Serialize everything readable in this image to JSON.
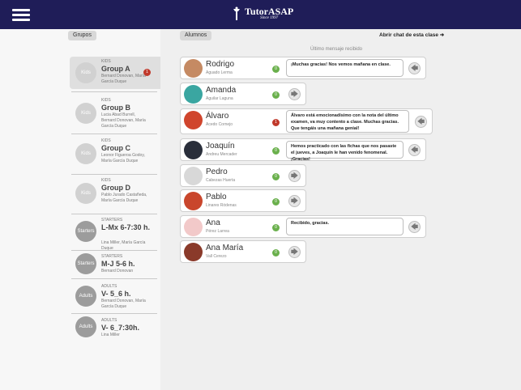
{
  "header": {
    "brand": "TutorASAP",
    "since": "Since 1997"
  },
  "left": {
    "tab_label": "Grupos",
    "groups": [
      {
        "kind": "KIDS",
        "name": "Group A",
        "members": "Bernard Donovan, María García Duque",
        "avatar": "Kids",
        "badge": "1"
      },
      {
        "kind": "KIDS",
        "name": "Group B",
        "members": "Lucia Abad Burrell, Bernard Donovan, María García Duque",
        "avatar": "Kids"
      },
      {
        "kind": "KIDS",
        "name": "Group C",
        "members": "Leonor Figueroa Godoy, María García Duque",
        "avatar": "Kids"
      },
      {
        "kind": "KIDS",
        "name": "Group D",
        "members": "Pablo Jurado Castañeda, María García Duque",
        "avatar": "Kids"
      },
      {
        "kind": "STARTERS",
        "name": "L-Mx 6-7:30 h.",
        "members": "Lina Miller, María García Duque",
        "avatar": "Starters"
      },
      {
        "kind": "STARTERS",
        "name": "M-J 5-6 h.",
        "members": "Bernard Donovan",
        "avatar": "Starters"
      },
      {
        "kind": "ADULTS",
        "name": "V- 5_6 h.",
        "members": "Bernard Donovan, María García Duque",
        "avatar": "Adults"
      },
      {
        "kind": "ADULTS",
        "name": "V- 6_7:30h.",
        "members": "Lina Miller",
        "avatar": "Adults"
      }
    ]
  },
  "right": {
    "tab_label": "Alumnos",
    "open_chat_label": "Abrir chat de esta clase",
    "open_chat_arrow": "➜",
    "last_message_label": "Último mensaje recibido",
    "students": [
      {
        "name": "Rodrigo",
        "surname": "Aguado Lerma",
        "count": "0",
        "count_color": "green",
        "message": "¡Muchas gracias! Nos vemos mañana en clase.",
        "arrow": "🡄",
        "avatar_color": "#c58a63"
      },
      {
        "name": "Amanda",
        "surname": "Aguilar Laguna",
        "count": "0",
        "count_color": "green",
        "arrow": "🡆",
        "avatar_color": "#3aa6a1"
      },
      {
        "name": "Álvaro",
        "surname": "Acedo Cornejo",
        "count": "1",
        "count_color": "red",
        "message": "Álvaro está emocionadísimo con la nota del último examen, va muy contento a clase. Muchas gracias. Que tengáis una mañana genial!",
        "arrow": "🡄",
        "avatar_color": "#d0452d"
      },
      {
        "name": "Joaquín",
        "surname": "Andreu Mercader",
        "count": "0",
        "count_color": "green",
        "message": "Hemos practicado con las fichas que nos pasaste el jueves, a Joaquín le han venido fenomenal. ¡Gracias!",
        "arrow": "🡄",
        "avatar_color": "#2a2f3b"
      },
      {
        "name": "Pedro",
        "surname": "Cabezas Huerta",
        "count": "0",
        "count_color": "green",
        "arrow": "🡆",
        "avatar_color": "#d8d8d8"
      },
      {
        "name": "Pablo",
        "surname": "Linares Ródenas",
        "count": "0",
        "count_color": "green",
        "arrow": "🡆",
        "avatar_color": "#c9462c"
      },
      {
        "name": "Ana",
        "surname": "Pérez Larrea",
        "count": "0",
        "count_color": "green",
        "message": "Recibido, gracias.",
        "arrow": "🡄",
        "avatar_color": "#f2c9c9"
      },
      {
        "name": "Ana María",
        "surname": "Vall Cerezo",
        "count": "0",
        "count_color": "green",
        "arrow": "🡆",
        "avatar_color": "#8a3a2a"
      }
    ]
  }
}
